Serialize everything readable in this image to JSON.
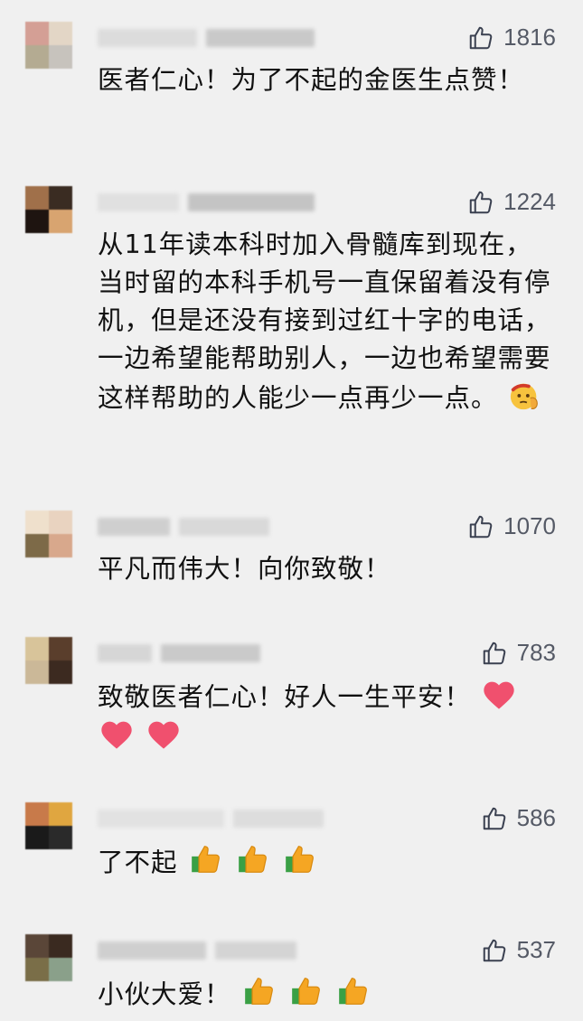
{
  "comments": [
    {
      "likes": "1816",
      "text": "医者仁心！为了不起的金医生点赞！",
      "emojis": []
    },
    {
      "likes": "1224",
      "text": "从11年读本科时加入骨髓库到现在，当时留的本科手机号一直保留着没有停机，但是还没有接到过红十字的电话，一边希望能帮助别人，一边也希望需要这样帮助的人能少一点再少一点。",
      "emojis": [
        "saluting-face-emoji"
      ]
    },
    {
      "likes": "1070",
      "text": "平凡而伟大！向你致敬！",
      "emojis": []
    },
    {
      "likes": "783",
      "text": "致敬医者仁心！好人一生平安！",
      "emojis": [
        "heart-emoji",
        "heart-emoji",
        "heart-emoji"
      ]
    },
    {
      "likes": "586",
      "text": "了不起",
      "emojis": [
        "thumbs-up-emoji",
        "thumbs-up-emoji",
        "thumbs-up-emoji"
      ]
    },
    {
      "likes": "537",
      "text": "小伙大爱！",
      "emojis": [
        "thumbs-up-emoji",
        "thumbs-up-emoji",
        "thumbs-up-emoji"
      ]
    }
  ],
  "colors": {
    "background": "#f0f0f0",
    "text": "#111111",
    "like_count": "#555a66",
    "heart": "#f0506e",
    "thumbs": "#f5a623"
  }
}
